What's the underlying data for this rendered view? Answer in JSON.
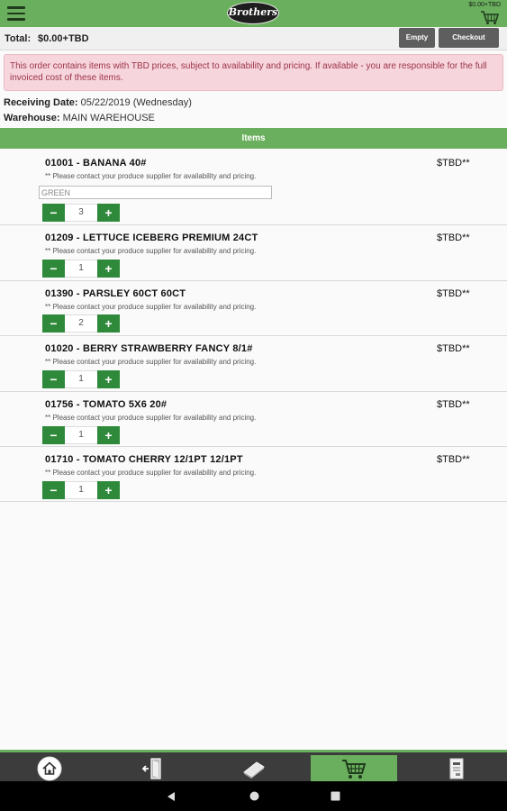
{
  "header": {
    "logo_text": "Brothers",
    "cart_total": "$0.00+TBD"
  },
  "totalbar": {
    "label": "Total:",
    "value": "$0.00+TBD",
    "empty_label": "Empty",
    "checkout_label": "Checkout"
  },
  "alert": {
    "text": "This order contains items with TBD prices, subject to availability and pricing. If available - you are responsible for the full invoiced cost of these items."
  },
  "info": {
    "receiving_label": "Receiving Date:",
    "receiving_value": "05/22/2019 (Wednesday)",
    "warehouse_label": "Warehouse:",
    "warehouse_value": "MAIN WAREHOUSE"
  },
  "items_header": "Items",
  "items": [
    {
      "title": "01001 - BANANA 40#",
      "price": "$TBD**",
      "note": "** Please contact your produce supplier for availability and pricing.",
      "comment": "GREEN",
      "qty": "3"
    },
    {
      "title": "01209 - LETTUCE ICEBERG PREMIUM 24CT",
      "price": "$TBD**",
      "note": "** Please contact your produce supplier for availability and pricing.",
      "qty": "1"
    },
    {
      "title": "01390 - PARSLEY 60CT 60CT",
      "price": "$TBD**",
      "note": "** Please contact your produce supplier for availability and pricing.",
      "qty": "2"
    },
    {
      "title": "01020 - BERRY STRAWBERRY FANCY 8/1#",
      "price": "$TBD**",
      "note": "** Please contact your produce supplier for availability and pricing.",
      "qty": "1"
    },
    {
      "title": "01756 - TOMATO 5X6 20#",
      "price": "$TBD**",
      "note": "** Please contact your produce supplier for availability and pricing.",
      "qty": "1"
    },
    {
      "title": "01710 - TOMATO CHERRY 12/1PT 12/1PT",
      "price": "$TBD**",
      "note": "** Please contact your produce supplier for availability and pricing.",
      "qty": "1"
    }
  ],
  "stepper": {
    "minus": "−",
    "plus": "+"
  },
  "bottom_nav": [
    {
      "icon": "home-icon"
    },
    {
      "icon": "logout-door-icon"
    },
    {
      "icon": "catalog-book-icon"
    },
    {
      "icon": "cart-icon",
      "active": true
    },
    {
      "icon": "order-document-icon"
    }
  ],
  "colors": {
    "brand_green": "#6aaf5d",
    "stepper_green": "#2e8a3a",
    "alert_bg": "#f6d5dc",
    "alert_text": "#9c3348"
  }
}
